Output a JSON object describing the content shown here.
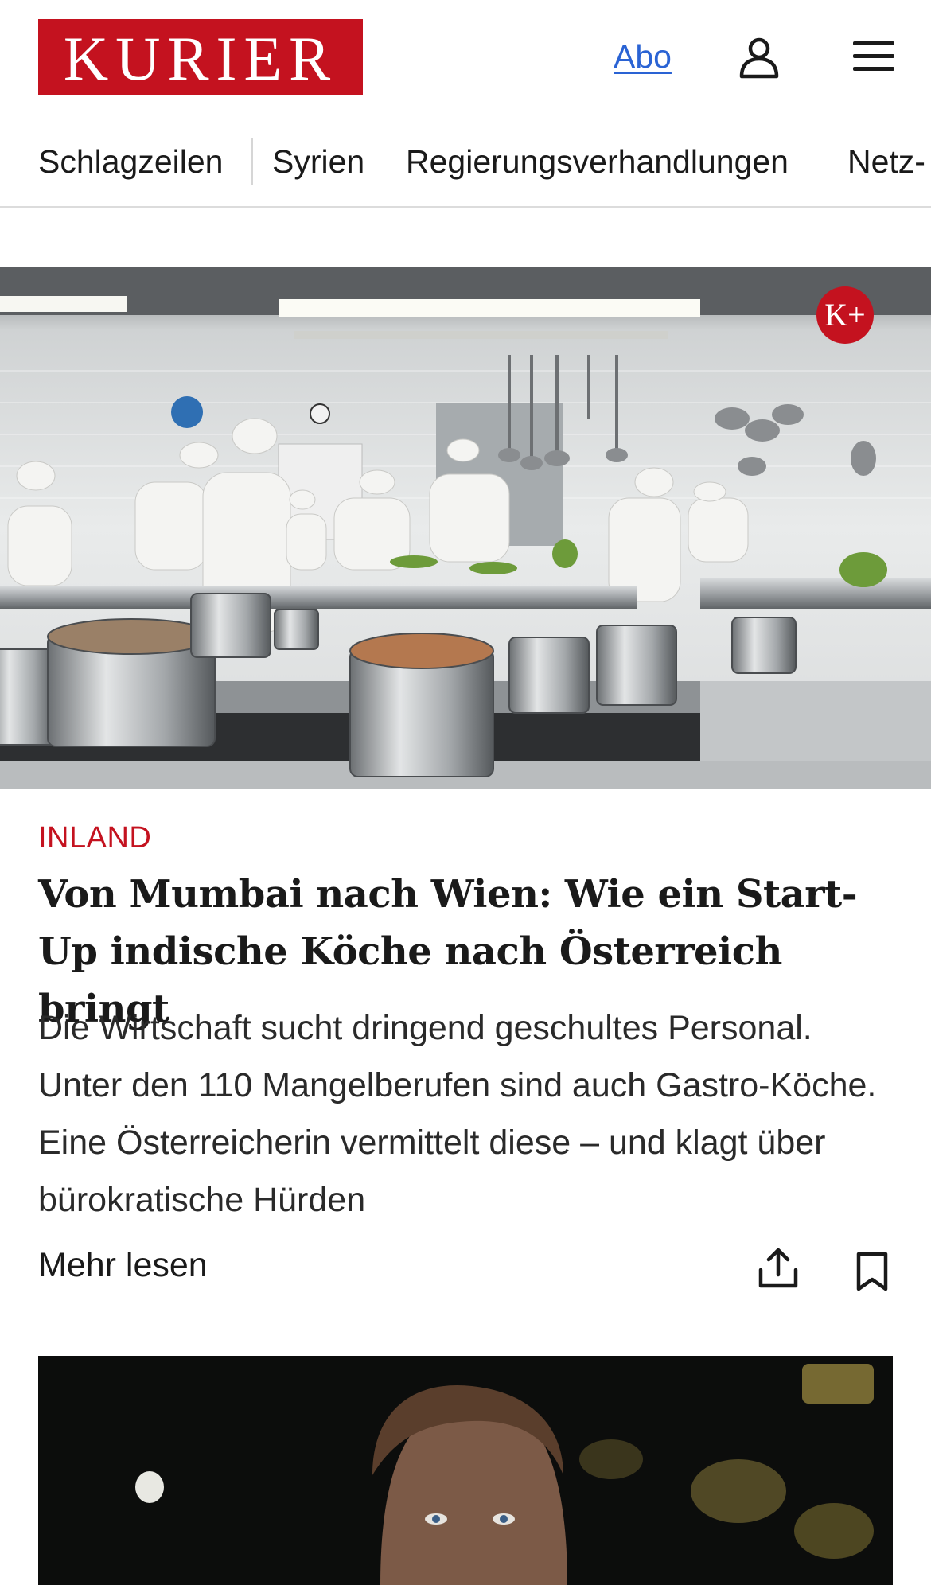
{
  "header": {
    "logo_text": "KURIER",
    "abo_label": "Abo",
    "user_icon": "user-icon",
    "menu_icon": "hamburger-menu-icon"
  },
  "nav": {
    "items": [
      {
        "label": "Schlagzeilen"
      },
      {
        "label": "Syrien"
      },
      {
        "label": "Regierungsverhandlungen"
      },
      {
        "label": "Netz-"
      }
    ]
  },
  "article": {
    "badge": "K+",
    "kicker": "INLAND",
    "headline": "Von Mumbai nach Wien: Wie ein Start-Up indische Köche nach Österreich bringt",
    "teaser": "Die Wirtschaft sucht dringend geschultes Personal. Unter den 110 Mangelberufen sind auch Gastro-Köche. Eine Österreicherin vermittelt diese – und klagt über bürokratische Hürden",
    "more_label": "Mehr lesen",
    "share_icon": "share-icon",
    "bookmark_icon": "bookmark-icon"
  },
  "colors": {
    "brand": "#c4121f",
    "link": "#2a63d4",
    "text": "#1a1a1a"
  }
}
